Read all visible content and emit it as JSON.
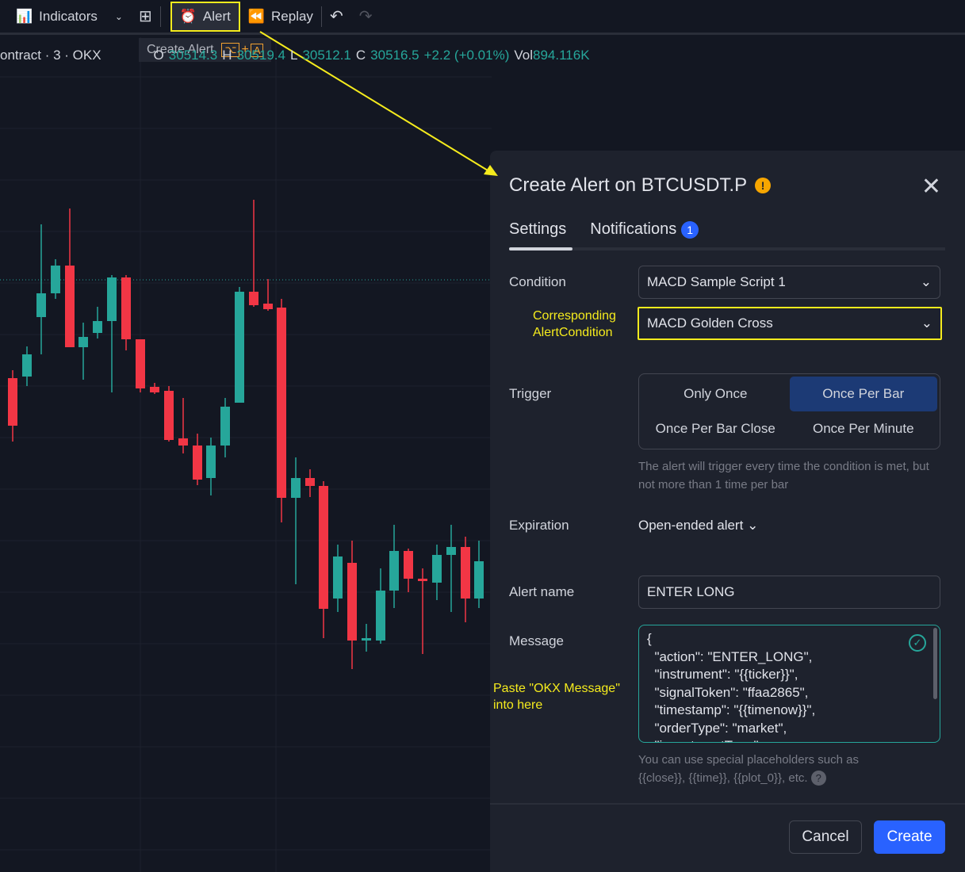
{
  "toolbar": {
    "indicators": "Indicators",
    "alert": "Alert",
    "replay": "Replay"
  },
  "tooltip": {
    "label": "Create Alert",
    "shortcut_key1": "⌥",
    "plus": "+",
    "shortcut_key2": "A"
  },
  "legend": {
    "symbol": "ontract · 3 · OKX",
    "o_label": "O",
    "o": "30514.3",
    "h_label": "H",
    "h": "30519.4",
    "l_label": "L",
    "l": "30512.1",
    "c_label": "C",
    "c": "30516.5",
    "change": "+2.2 (+0.01%)",
    "vol_label": "Vol",
    "vol": "894.116K"
  },
  "colors": {
    "up": "#26a69a",
    "down": "#f23645",
    "accent": "#2962ff",
    "annotation": "#f5eb1d"
  },
  "dialog": {
    "title": "Create Alert on BTCUSDT.P",
    "tabs": [
      {
        "label": "Settings"
      },
      {
        "label": "Notifications",
        "badge": "1"
      }
    ],
    "condition_label": "Condition",
    "condition_value": "MACD Sample Script 1",
    "annotation_condition": "Corresponding AlertCondition",
    "alertcondition_value": "MACD Golden Cross",
    "trigger_label": "Trigger",
    "trigger_options": [
      "Only Once",
      "Once Per Bar",
      "Once Per Bar Close",
      "Once Per Minute"
    ],
    "trigger_selected": "Once Per Bar",
    "trigger_hint": "The alert will trigger every time the condition is met, but not more than 1 time per bar",
    "expiration_label": "Expiration",
    "expiration_value": "Open-ended alert",
    "name_label": "Alert name",
    "name_value": "ENTER LONG",
    "message_label": "Message",
    "annotation_message": "Paste \"OKX Message\" into here",
    "message_value": "{\n  \"action\": \"ENTER_LONG\",\n  \"instrument\": \"{{ticker}}\",\n  \"signalToken\": \"ffaa2865\",\n  \"timestamp\": \"{{timenow}}\",\n  \"orderType\": \"market\",\n  \"investmentType\": ",
    "message_hint": "You can use special placeholders such as {{close}}, {{time}}, {{plot_0}}, etc.",
    "cancel": "Cancel",
    "create": "Create"
  }
}
